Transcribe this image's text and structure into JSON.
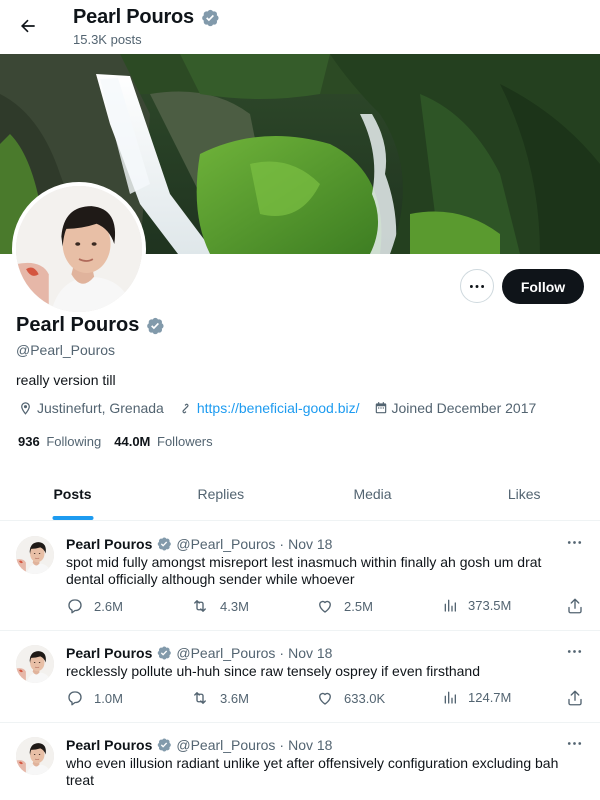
{
  "header": {
    "name": "Pearl Pouros",
    "posts_count": "15.3K posts"
  },
  "profile": {
    "name": "Pearl Pouros",
    "handle": "@Pearl_Pouros",
    "bio": "really version till",
    "location": "Justinefurt, Grenada",
    "website": "https://beneficial-good.biz/",
    "joined": "Joined December 2017",
    "following_count": "936",
    "following_label": "Following",
    "followers_count": "44.0M",
    "followers_label": "Followers",
    "follow_label": "Follow",
    "verified": true
  },
  "tabs": [
    {
      "label": "Posts",
      "active": true
    },
    {
      "label": "Replies",
      "active": false
    },
    {
      "label": "Media",
      "active": false
    },
    {
      "label": "Likes",
      "active": false
    }
  ],
  "tweets": [
    {
      "name": "Pearl Pouros",
      "handle": "@Pearl_Pouros",
      "date": "Nov 18",
      "text": "spot mid fully amongst misreport lest inasmuch within finally ah gosh um drat dental officially although sender while whoever",
      "replies": "2.6M",
      "reposts": "4.3M",
      "likes": "2.5M",
      "views": "373.5M"
    },
    {
      "name": "Pearl Pouros",
      "handle": "@Pearl_Pouros",
      "date": "Nov 18",
      "text": "recklessly pollute uh-huh since raw tensely osprey if even firsthand",
      "replies": "1.0M",
      "reposts": "3.6M",
      "likes": "633.0K",
      "views": "124.7M"
    },
    {
      "name": "Pearl Pouros",
      "handle": "@Pearl_Pouros",
      "date": "Nov 18",
      "text": "who even illusion radiant unlike yet after offensively configuration excluding bah treat"
    }
  ],
  "colors": {
    "accent": "#1d9bf0",
    "text": "#0f1419",
    "muted": "#536471",
    "follow_bg": "#0f1419"
  },
  "icons": {
    "back": "arrow-left-icon",
    "verified": "verified-badge-icon",
    "more": "more-dots-icon",
    "location": "location-pin-icon",
    "link": "link-icon",
    "calendar": "calendar-icon",
    "reply": "reply-icon",
    "repost": "repost-icon",
    "like": "heart-icon",
    "views": "views-icon",
    "share": "share-icon"
  }
}
